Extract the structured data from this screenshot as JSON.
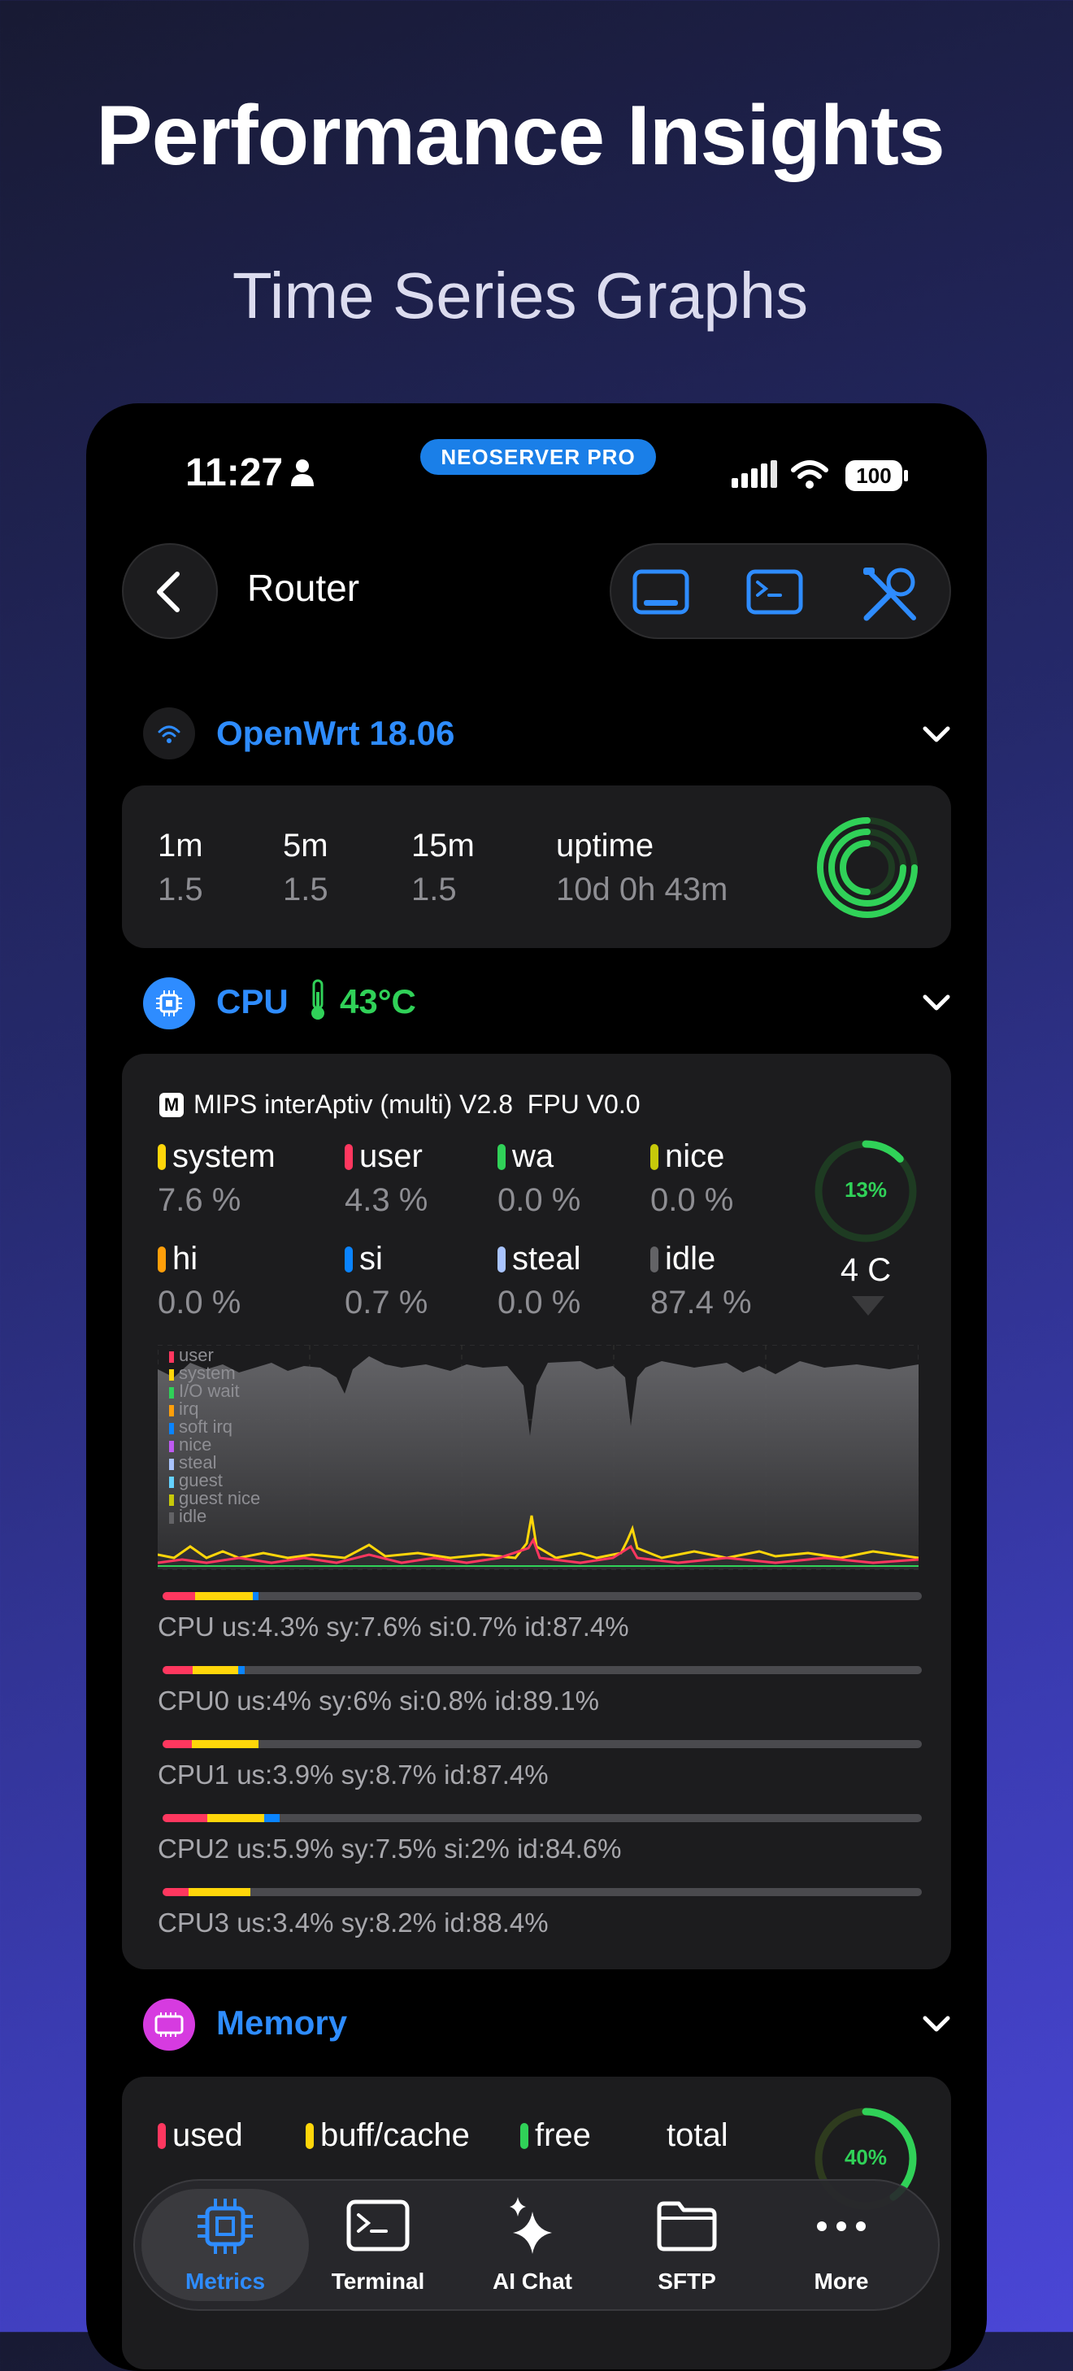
{
  "promo": {
    "headline": "Performance Insights",
    "subheadline": "Time Series Graphs"
  },
  "status_bar": {
    "time": "11:27",
    "app_badge": "NEOSERVER PRO",
    "battery": "100"
  },
  "header": {
    "title": "Router",
    "toolbar_icons": [
      "display-icon",
      "terminal-icon",
      "tools-icon"
    ]
  },
  "system_section": {
    "title": "OpenWrt 18.06",
    "load": [
      {
        "label": "1m",
        "value": "1.5"
      },
      {
        "label": "5m",
        "value": "1.5"
      },
      {
        "label": "15m",
        "value": "1.5"
      }
    ],
    "uptime_label": "uptime",
    "uptime_value": "10d 0h 43m"
  },
  "cpu_section": {
    "title": "CPU",
    "temperature": "43°C",
    "model_badge": "M",
    "model": "MIPS interAptiv (multi) V2.8  FPU V0.0",
    "stats": [
      {
        "label": "system",
        "value": "7.6 %",
        "color": "#ffd60a"
      },
      {
        "label": "user",
        "value": "4.3 %",
        "color": "#ff375f"
      },
      {
        "label": "wa",
        "value": "0.0 %",
        "color": "#30d158"
      },
      {
        "label": "nice",
        "value": "0.0 %",
        "color": "#c7c90a"
      },
      {
        "label": "hi",
        "value": "0.0 %",
        "color": "#ff9f0a"
      },
      {
        "label": "si",
        "value": "0.7 %",
        "color": "#0a84ff"
      },
      {
        "label": "steal",
        "value": "0.0 %",
        "color": "#a9c4ff"
      },
      {
        "label": "idle",
        "value": "87.4 %",
        "color": "#636366"
      }
    ],
    "gauge_percent": "13%",
    "gauge_fraction": 0.13,
    "cores": "4 C",
    "legend": [
      "user",
      "system",
      "I/O wait",
      "irq",
      "soft irq",
      "nice",
      "steal",
      "guest",
      "guest nice",
      "idle"
    ],
    "legend_colors": [
      "#ff375f",
      "#ffd60a",
      "#30d158",
      "#ff9f0a",
      "#0a84ff",
      "#bf5af2",
      "#a9c4ff",
      "#64d2ff",
      "#c7c90a",
      "#636366"
    ],
    "bars": [
      {
        "text": "CPU us:4.3% sy:7.6% si:0.7% id:87.4%",
        "us": 4.3,
        "sy": 7.6,
        "si": 0.7
      },
      {
        "text": "CPU0 us:4% sy:6% si:0.8% id:89.1%",
        "us": 4,
        "sy": 6,
        "si": 0.8
      },
      {
        "text": "CPU1 us:3.9% sy:8.7% id:87.4%",
        "us": 3.9,
        "sy": 8.7,
        "si": 0
      },
      {
        "text": "CPU2 us:5.9% sy:7.5% si:2% id:84.6%",
        "us": 5.9,
        "sy": 7.5,
        "si": 2
      },
      {
        "text": "CPU3 us:3.4% sy:8.2% id:88.4%",
        "us": 3.4,
        "sy": 8.2,
        "si": 0
      }
    ]
  },
  "memory_section": {
    "title": "Memory",
    "stats": [
      {
        "label": "used",
        "color": "#ff375f"
      },
      {
        "label": "buff/cache",
        "color": "#ffd60a"
      },
      {
        "label": "free",
        "color": "#30d158"
      },
      {
        "label": "total",
        "color": ""
      }
    ],
    "gauge_percent": "40%",
    "gauge_fraction": 0.4
  },
  "tabbar": {
    "tabs": [
      {
        "label": "Metrics",
        "icon": "chip-icon",
        "active": true
      },
      {
        "label": "Terminal",
        "icon": "terminal-icon",
        "active": false
      },
      {
        "label": "AI Chat",
        "icon": "sparkles-icon",
        "active": false
      },
      {
        "label": "SFTP",
        "icon": "folder-icon",
        "active": false
      },
      {
        "label": "More",
        "icon": "ellipsis-icon",
        "active": false
      }
    ]
  }
}
